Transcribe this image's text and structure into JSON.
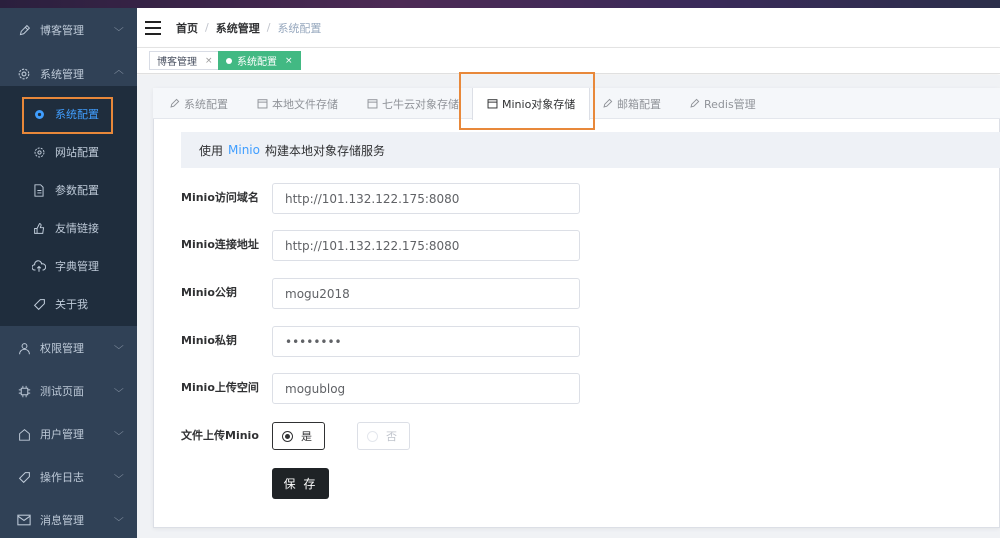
{
  "sidebar": {
    "items": [
      {
        "label": "博客管理",
        "icon": "edit-icon"
      },
      {
        "label": "系统管理",
        "icon": "gear-icon"
      },
      {
        "label": "权限管理",
        "icon": "user-icon"
      },
      {
        "label": "测试页面",
        "icon": "chip-icon"
      },
      {
        "label": "用户管理",
        "icon": "home-icon"
      },
      {
        "label": "操作日志",
        "icon": "tag-icon"
      },
      {
        "label": "消息管理",
        "icon": "mail-icon"
      }
    ],
    "system_children": [
      {
        "label": "系统配置",
        "icon": "gear-icon",
        "active": true
      },
      {
        "label": "网站配置",
        "icon": "gear-outline-icon"
      },
      {
        "label": "参数配置",
        "icon": "document-icon"
      },
      {
        "label": "友情链接",
        "icon": "thumbs-up-icon"
      },
      {
        "label": "字典管理",
        "icon": "cloud-upload-icon"
      },
      {
        "label": "关于我",
        "icon": "tag-icon"
      }
    ]
  },
  "header": {
    "breadcrumb": [
      "首页",
      "系统管理",
      "系统配置"
    ]
  },
  "tags": [
    {
      "label": "博客管理",
      "active": false
    },
    {
      "label": "系统配置",
      "active": true
    }
  ],
  "tabs": [
    {
      "label": "系统配置",
      "icon": "edit-icon"
    },
    {
      "label": "本地文件存储",
      "icon": "calendar-icon"
    },
    {
      "label": "七牛云对象存储",
      "icon": "calendar-icon"
    },
    {
      "label": "Minio对象存储",
      "icon": "calendar-icon",
      "active": true
    },
    {
      "label": "邮箱配置",
      "icon": "edit-icon"
    },
    {
      "label": "Redis管理",
      "icon": "edit-icon"
    }
  ],
  "info": {
    "prefix": "使用",
    "brand": "Minio",
    "suffix": "构建本地对象存储服务"
  },
  "form": {
    "fields": [
      {
        "label": "Minio访问域名",
        "value": "http://101.132.122.175:8080"
      },
      {
        "label": "Minio连接地址",
        "value": "http://101.132.122.175:8080"
      },
      {
        "label": "Minio公钥",
        "value": "mogu2018"
      },
      {
        "label": "Minio私钥",
        "value": "••••••••"
      },
      {
        "label": "Minio上传空间",
        "value": "mogublog"
      }
    ],
    "upload_label": "文件上传Minio",
    "options": [
      "是",
      "否"
    ],
    "selected": "是",
    "save_label": "保 存"
  },
  "colors": {
    "sidebar_bg": "#304156",
    "submenu_bg": "#1f2d3d",
    "active_blue": "#409eff",
    "tag_green": "#42b983",
    "highlight_orange": "#e8883a",
    "button_dark": "#1f2326"
  }
}
